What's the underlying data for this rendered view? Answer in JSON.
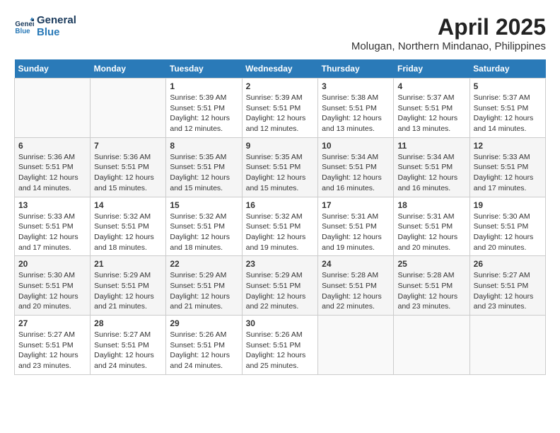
{
  "logo": {
    "line1": "General",
    "line2": "Blue"
  },
  "title": "April 2025",
  "subtitle": "Molugan, Northern Mindanao, Philippines",
  "days_of_week": [
    "Sunday",
    "Monday",
    "Tuesday",
    "Wednesday",
    "Thursday",
    "Friday",
    "Saturday"
  ],
  "weeks": [
    [
      null,
      null,
      {
        "day": "1",
        "sunrise": "5:39 AM",
        "sunset": "5:51 PM",
        "daylight": "12 hours and 12 minutes."
      },
      {
        "day": "2",
        "sunrise": "5:39 AM",
        "sunset": "5:51 PM",
        "daylight": "12 hours and 12 minutes."
      },
      {
        "day": "3",
        "sunrise": "5:38 AM",
        "sunset": "5:51 PM",
        "daylight": "12 hours and 13 minutes."
      },
      {
        "day": "4",
        "sunrise": "5:37 AM",
        "sunset": "5:51 PM",
        "daylight": "12 hours and 13 minutes."
      },
      {
        "day": "5",
        "sunrise": "5:37 AM",
        "sunset": "5:51 PM",
        "daylight": "12 hours and 14 minutes."
      }
    ],
    [
      {
        "day": "6",
        "sunrise": "5:36 AM",
        "sunset": "5:51 PM",
        "daylight": "12 hours and 14 minutes."
      },
      {
        "day": "7",
        "sunrise": "5:36 AM",
        "sunset": "5:51 PM",
        "daylight": "12 hours and 15 minutes."
      },
      {
        "day": "8",
        "sunrise": "5:35 AM",
        "sunset": "5:51 PM",
        "daylight": "12 hours and 15 minutes."
      },
      {
        "day": "9",
        "sunrise": "5:35 AM",
        "sunset": "5:51 PM",
        "daylight": "12 hours and 15 minutes."
      },
      {
        "day": "10",
        "sunrise": "5:34 AM",
        "sunset": "5:51 PM",
        "daylight": "12 hours and 16 minutes."
      },
      {
        "day": "11",
        "sunrise": "5:34 AM",
        "sunset": "5:51 PM",
        "daylight": "12 hours and 16 minutes."
      },
      {
        "day": "12",
        "sunrise": "5:33 AM",
        "sunset": "5:51 PM",
        "daylight": "12 hours and 17 minutes."
      }
    ],
    [
      {
        "day": "13",
        "sunrise": "5:33 AM",
        "sunset": "5:51 PM",
        "daylight": "12 hours and 17 minutes."
      },
      {
        "day": "14",
        "sunrise": "5:32 AM",
        "sunset": "5:51 PM",
        "daylight": "12 hours and 18 minutes."
      },
      {
        "day": "15",
        "sunrise": "5:32 AM",
        "sunset": "5:51 PM",
        "daylight": "12 hours and 18 minutes."
      },
      {
        "day": "16",
        "sunrise": "5:32 AM",
        "sunset": "5:51 PM",
        "daylight": "12 hours and 19 minutes."
      },
      {
        "day": "17",
        "sunrise": "5:31 AM",
        "sunset": "5:51 PM",
        "daylight": "12 hours and 19 minutes."
      },
      {
        "day": "18",
        "sunrise": "5:31 AM",
        "sunset": "5:51 PM",
        "daylight": "12 hours and 20 minutes."
      },
      {
        "day": "19",
        "sunrise": "5:30 AM",
        "sunset": "5:51 PM",
        "daylight": "12 hours and 20 minutes."
      }
    ],
    [
      {
        "day": "20",
        "sunrise": "5:30 AM",
        "sunset": "5:51 PM",
        "daylight": "12 hours and 20 minutes."
      },
      {
        "day": "21",
        "sunrise": "5:29 AM",
        "sunset": "5:51 PM",
        "daylight": "12 hours and 21 minutes."
      },
      {
        "day": "22",
        "sunrise": "5:29 AM",
        "sunset": "5:51 PM",
        "daylight": "12 hours and 21 minutes."
      },
      {
        "day": "23",
        "sunrise": "5:29 AM",
        "sunset": "5:51 PM",
        "daylight": "12 hours and 22 minutes."
      },
      {
        "day": "24",
        "sunrise": "5:28 AM",
        "sunset": "5:51 PM",
        "daylight": "12 hours and 22 minutes."
      },
      {
        "day": "25",
        "sunrise": "5:28 AM",
        "sunset": "5:51 PM",
        "daylight": "12 hours and 23 minutes."
      },
      {
        "day": "26",
        "sunrise": "5:27 AM",
        "sunset": "5:51 PM",
        "daylight": "12 hours and 23 minutes."
      }
    ],
    [
      {
        "day": "27",
        "sunrise": "5:27 AM",
        "sunset": "5:51 PM",
        "daylight": "12 hours and 23 minutes."
      },
      {
        "day": "28",
        "sunrise": "5:27 AM",
        "sunset": "5:51 PM",
        "daylight": "12 hours and 24 minutes."
      },
      {
        "day": "29",
        "sunrise": "5:26 AM",
        "sunset": "5:51 PM",
        "daylight": "12 hours and 24 minutes."
      },
      {
        "day": "30",
        "sunrise": "5:26 AM",
        "sunset": "5:51 PM",
        "daylight": "12 hours and 25 minutes."
      },
      null,
      null,
      null
    ]
  ],
  "cell_labels": {
    "sunrise": "Sunrise:",
    "sunset": "Sunset:",
    "daylight": "Daylight:"
  }
}
